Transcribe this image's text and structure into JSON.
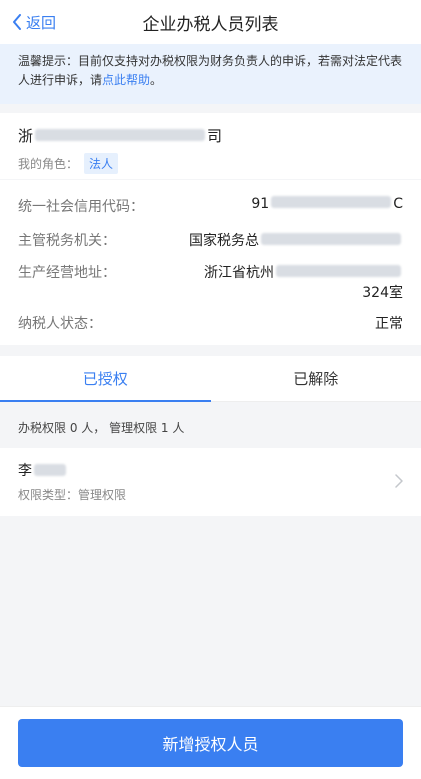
{
  "nav": {
    "back_label": "返回",
    "title": "企业办税人员列表"
  },
  "notice": {
    "text": "温馨提示：目前仅支持对办税权限为财务负责人的申诉，若需对法定代表人进行申诉，请",
    "link": "点此帮助",
    "suffix": "。"
  },
  "company": {
    "name_prefix": "浙",
    "name_suffix": "司",
    "role_label": "我的角色：",
    "role_badge": "法人"
  },
  "details": {
    "credit_code_label": "统一社会信用代码：",
    "credit_code_prefix": "91",
    "credit_code_suffix": "C",
    "tax_office_label": "主管税务机关：",
    "tax_office_prefix": "国家税务总",
    "address_label": "生产经营地址：",
    "address_prefix": "浙江省杭州",
    "address_suffix": "324室",
    "status_label": "纳税人状态：",
    "status_value": "正常"
  },
  "tabs": [
    {
      "label": "已授权",
      "active": true
    },
    {
      "label": "已解除",
      "active": false
    }
  ],
  "summary": "办税权限 0 人， 管理权限 1 人",
  "person": {
    "name_prefix": "李",
    "type_text": "权限类型：管理权限"
  },
  "bottom": {
    "button_label": "新增授权人员"
  },
  "colors": {
    "accent": "#3a7ff1",
    "notice_bg": "#eaf2fd"
  }
}
